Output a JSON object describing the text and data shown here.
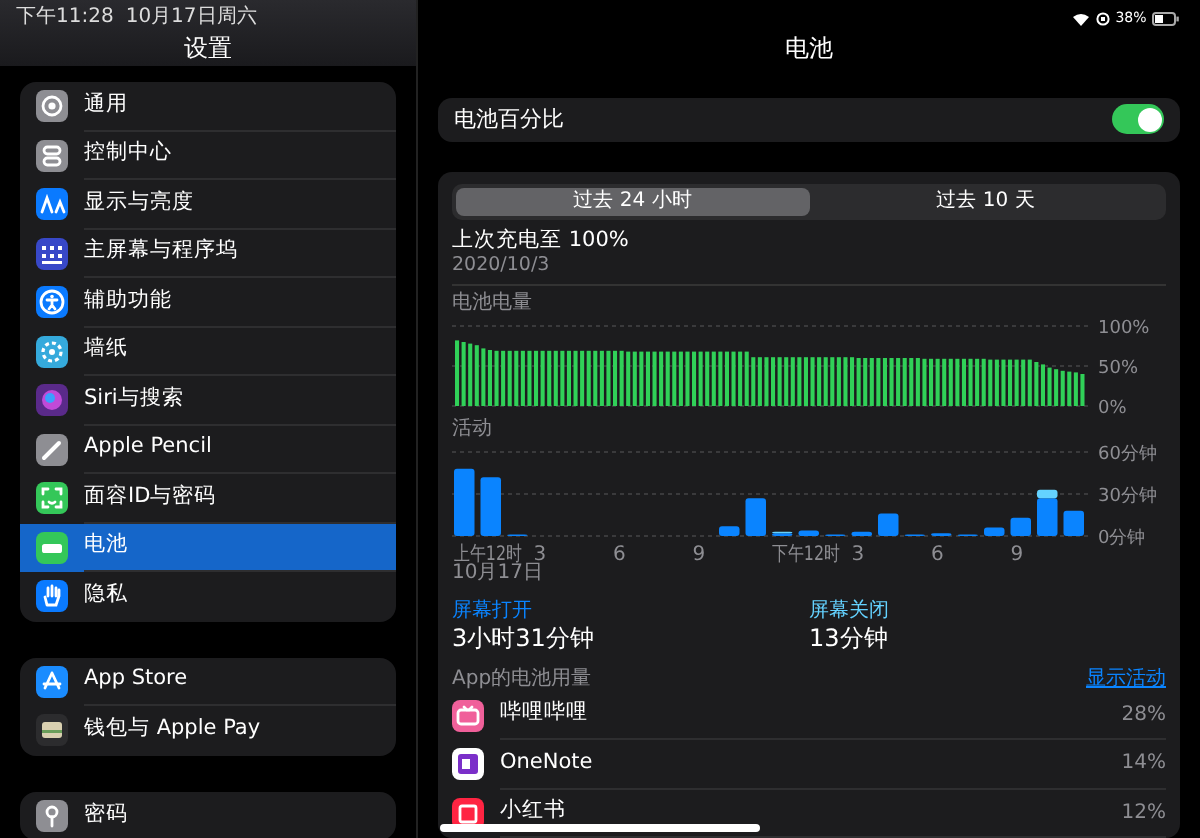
{
  "status_bar": {
    "time": "下午11:28",
    "date": "10月17日周六",
    "battery_percent": "38%"
  },
  "sidebar": {
    "title": "设置",
    "groups": [
      {
        "items": [
          {
            "label": "通用",
            "kind": "gear",
            "color": "#8e8e93",
            "selected": false
          },
          {
            "label": "控制中心",
            "kind": "toggles",
            "color": "#8e8e93",
            "selected": false
          },
          {
            "label": "显示与亮度",
            "kind": "display",
            "color": "#0a7aff",
            "selected": false
          },
          {
            "label": "主屏幕与程序坞",
            "kind": "grid",
            "color": "#3848c8",
            "selected": false
          },
          {
            "label": "辅助功能",
            "kind": "accessibility",
            "color": "#0a7aff",
            "selected": false
          },
          {
            "label": "墙纸",
            "kind": "flower",
            "color": "#35aadc",
            "selected": false
          },
          {
            "label": "Siri与搜索",
            "kind": "orb",
            "color": "#5a2a8a",
            "selected": false
          },
          {
            "label": "Apple Pencil",
            "kind": "pencil",
            "color": "#8e8e93",
            "selected": false
          },
          {
            "label": "面容ID与密码",
            "kind": "face",
            "color": "#34c759",
            "selected": false
          },
          {
            "label": "电池",
            "kind": "battery",
            "color": "#34c759",
            "selected": true
          },
          {
            "label": "隐私",
            "kind": "hand",
            "color": "#0a7aff",
            "selected": false
          }
        ]
      },
      {
        "items": [
          {
            "label": "App Store",
            "kind": "appstore",
            "color": "#1a8cff",
            "selected": false
          },
          {
            "label": "钱包与 Apple Pay",
            "kind": "wallet",
            "color": "#2c2c2e",
            "selected": false
          }
        ]
      },
      {
        "items": [
          {
            "label": "密码",
            "kind": "key",
            "color": "#8e8e93",
            "selected": false
          }
        ]
      }
    ]
  },
  "detail": {
    "title": "电池",
    "percentage_toggle": {
      "label": "电池百分比",
      "on": true
    },
    "segments": [
      {
        "label": "过去 24 小时",
        "selected": true
      },
      {
        "label": "过去 10 天",
        "selected": false
      }
    ],
    "last_charge": "上次充电至 100%",
    "last_charge_date": "2020/10/3",
    "battery_level": {
      "label": "电池电量",
      "chart_data": {
        "type": "bar",
        "ylim": [
          0,
          100
        ],
        "yticks": [
          {
            "value": 100,
            "label": "100%"
          },
          {
            "value": 50,
            "label": "50%"
          },
          {
            "value": 0,
            "label": "0%"
          }
        ],
        "values": [
          82,
          80,
          78,
          76,
          72,
          70,
          69,
          69,
          69,
          69,
          69,
          69,
          69,
          69,
          69,
          69,
          69,
          69,
          69,
          69,
          69,
          69,
          69,
          69,
          69,
          69,
          68,
          68,
          68,
          68,
          68,
          68,
          68,
          68,
          68,
          68,
          68,
          68,
          68,
          68,
          68,
          68,
          68,
          68,
          68,
          61,
          61,
          61,
          61,
          61,
          61,
          61,
          61,
          61,
          61,
          61,
          61,
          61,
          61,
          61,
          61,
          60,
          60,
          60,
          60,
          60,
          60,
          60,
          60,
          60,
          60,
          59,
          59,
          59,
          59,
          59,
          59,
          59,
          59,
          59,
          59,
          58,
          58,
          58,
          58,
          58,
          58,
          58,
          55,
          52,
          48,
          46,
          44,
          43,
          42,
          40
        ]
      }
    },
    "activity": {
      "label": "活动",
      "date_label": "10月17日",
      "axis_labels": [
        "上午12时",
        "3",
        "6",
        "9",
        "下午12时",
        "3",
        "6",
        "9"
      ],
      "chart_data": {
        "type": "bar",
        "stacked": true,
        "ylim": [
          0,
          60
        ],
        "yticks": [
          {
            "value": 60,
            "label": "60分钟"
          },
          {
            "value": 30,
            "label": "30分钟"
          },
          {
            "value": 0,
            "label": "0分钟"
          }
        ],
        "series": [
          {
            "name": "屏幕打开",
            "color": "#0a84ff",
            "values": [
              48,
              42,
              1,
              0,
              0,
              0,
              0,
              0,
              0,
              0,
              7,
              27,
              2,
              4,
              1,
              3,
              16,
              1,
              2,
              1,
              6,
              13,
              27,
              18
            ]
          },
          {
            "name": "屏幕关闭",
            "color": "#64d2ff",
            "values": [
              0,
              0,
              0,
              0,
              0,
              0,
              0,
              0,
              0,
              0,
              0,
              0,
              1,
              0,
              0,
              0,
              0,
              0,
              0,
              0,
              0,
              0,
              6,
              0
            ]
          }
        ]
      }
    },
    "screen_on": {
      "value": "3小时31分钟"
    },
    "screen_off": {
      "value": "13分钟"
    },
    "apps": {
      "title": "App的电池用量",
      "action": "显示活动",
      "items": [
        {
          "name": "哔哩哔哩",
          "percent": "28%",
          "kind": "tv",
          "color": "#f0609a"
        },
        {
          "name": "OneNote",
          "percent": "14%",
          "kind": "note",
          "color": "#ffffff"
        },
        {
          "name": "小红书",
          "percent": "12%",
          "kind": "book",
          "color": "#ff2442"
        }
      ]
    }
  }
}
